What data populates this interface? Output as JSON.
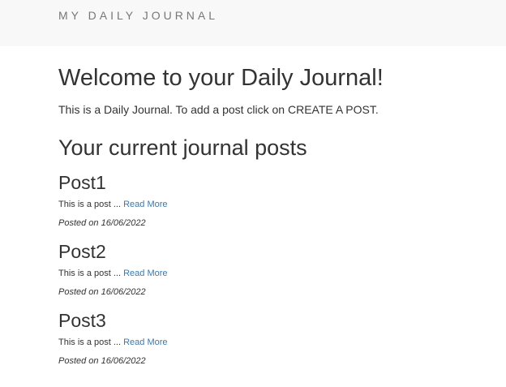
{
  "navbar": {
    "brand": "MY DAILY JOURNAL"
  },
  "main": {
    "heading": "Welcome to your Daily Journal!",
    "intro": "This is a Daily Journal. To add a post click on CREATE A POST.",
    "posts_heading": "Your current journal posts",
    "posts": [
      {
        "title": "Post1",
        "excerpt": "This is a post ...",
        "read_more": "Read More",
        "date": "Posted on 16/06/2022"
      },
      {
        "title": "Post2",
        "excerpt": "This is a post ...",
        "read_more": "Read More",
        "date": "Posted on 16/06/2022"
      },
      {
        "title": "Post3",
        "excerpt": "This is a post ...",
        "read_more": "Read More",
        "date": "Posted on 16/06/2022"
      }
    ]
  },
  "colors": {
    "navbar_background": "#f8f8f8",
    "brand_text": "#777777",
    "body_text": "#333333",
    "link": "#337ab7"
  }
}
